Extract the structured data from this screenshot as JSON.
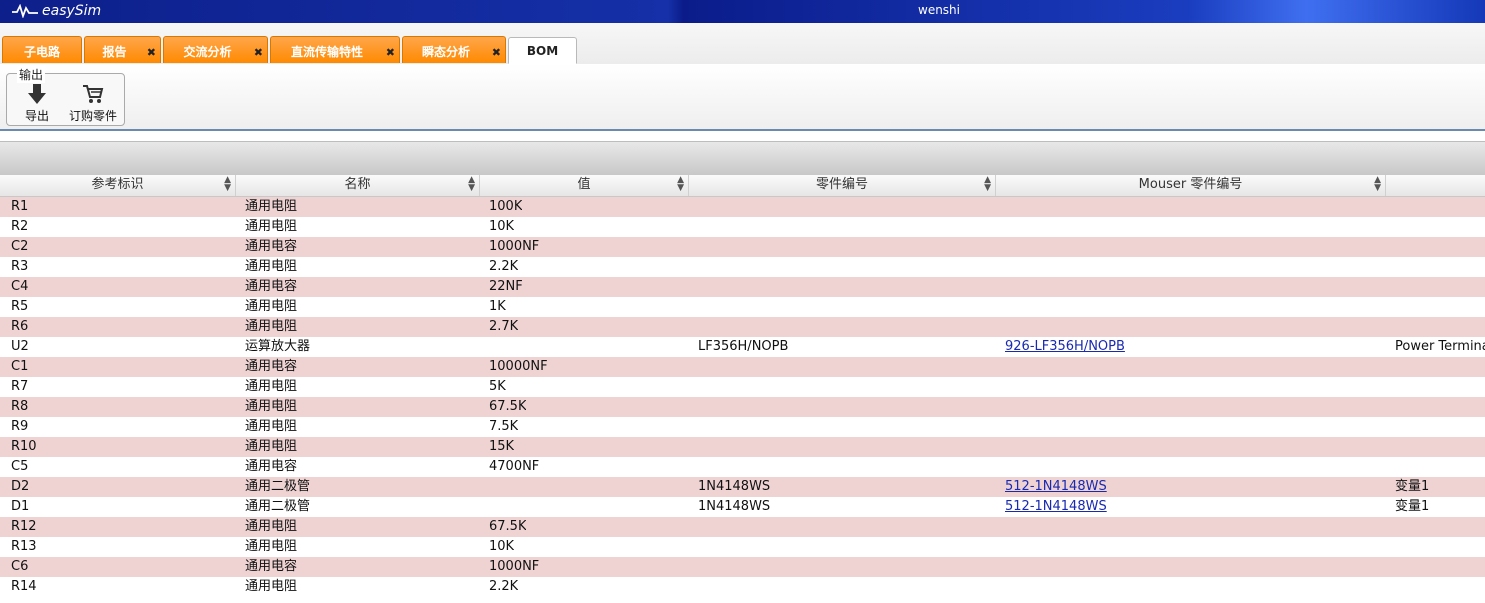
{
  "app": {
    "logo_text": "easySim",
    "user": "wenshi"
  },
  "tabs": [
    {
      "label": "子电路",
      "closable": false
    },
    {
      "label": "报告",
      "closable": true
    },
    {
      "label": "交流分析",
      "closable": true
    },
    {
      "label": "直流传输特性",
      "closable": true
    },
    {
      "label": "瞬态分析",
      "closable": true
    },
    {
      "label": "BOM",
      "closable": false,
      "active": true
    }
  ],
  "close_glyph": "✖",
  "toolbar": {
    "group_title": "输出",
    "export_label": "导出",
    "order_label": "订购零件"
  },
  "table": {
    "columns": [
      "参考标识",
      "名称",
      "值",
      "零件编号",
      "Mouser 零件编号",
      ""
    ],
    "rows": [
      [
        "R1",
        "通用电阻",
        "100K",
        "",
        "",
        ""
      ],
      [
        "R2",
        "通用电阻",
        "10K",
        "",
        "",
        ""
      ],
      [
        "C2",
        "通用电容",
        "1000NF",
        "",
        "",
        ""
      ],
      [
        "R3",
        "通用电阻",
        "2.2K",
        "",
        "",
        ""
      ],
      [
        "C4",
        "通用电容",
        "22NF",
        "",
        "",
        ""
      ],
      [
        "R5",
        "通用电阻",
        "1K",
        "",
        "",
        ""
      ],
      [
        "R6",
        "通用电阻",
        "2.7K",
        "",
        "",
        ""
      ],
      [
        "U2",
        "运算放大器",
        "",
        "LF356H/NOPB",
        "926-LF356H/NOPB",
        "Power Termina"
      ],
      [
        "C1",
        "通用电容",
        "10000NF",
        "",
        "",
        ""
      ],
      [
        "R7",
        "通用电阻",
        "5K",
        "",
        "",
        ""
      ],
      [
        "R8",
        "通用电阻",
        "67.5K",
        "",
        "",
        ""
      ],
      [
        "R9",
        "通用电阻",
        "7.5K",
        "",
        "",
        ""
      ],
      [
        "R10",
        "通用电阻",
        "15K",
        "",
        "",
        ""
      ],
      [
        "C5",
        "通用电容",
        "4700NF",
        "",
        "",
        ""
      ],
      [
        "D2",
        "通用二极管",
        "",
        "1N4148WS",
        "512-1N4148WS",
        "变量1"
      ],
      [
        "D1",
        "通用二极管",
        "",
        "1N4148WS",
        "512-1N4148WS",
        "变量1"
      ],
      [
        "R12",
        "通用电阻",
        "67.5K",
        "",
        "",
        ""
      ],
      [
        "R13",
        "通用电阻",
        "10K",
        "",
        "",
        ""
      ],
      [
        "C6",
        "通用电容",
        "1000NF",
        "",
        "",
        ""
      ],
      [
        "R14",
        "通用电阻",
        "2.2K",
        "",
        "",
        ""
      ]
    ]
  },
  "colors": {
    "tab_orange": "#ff8a00",
    "row_alt": "#efd3d3",
    "link": "#1a2ab0"
  }
}
